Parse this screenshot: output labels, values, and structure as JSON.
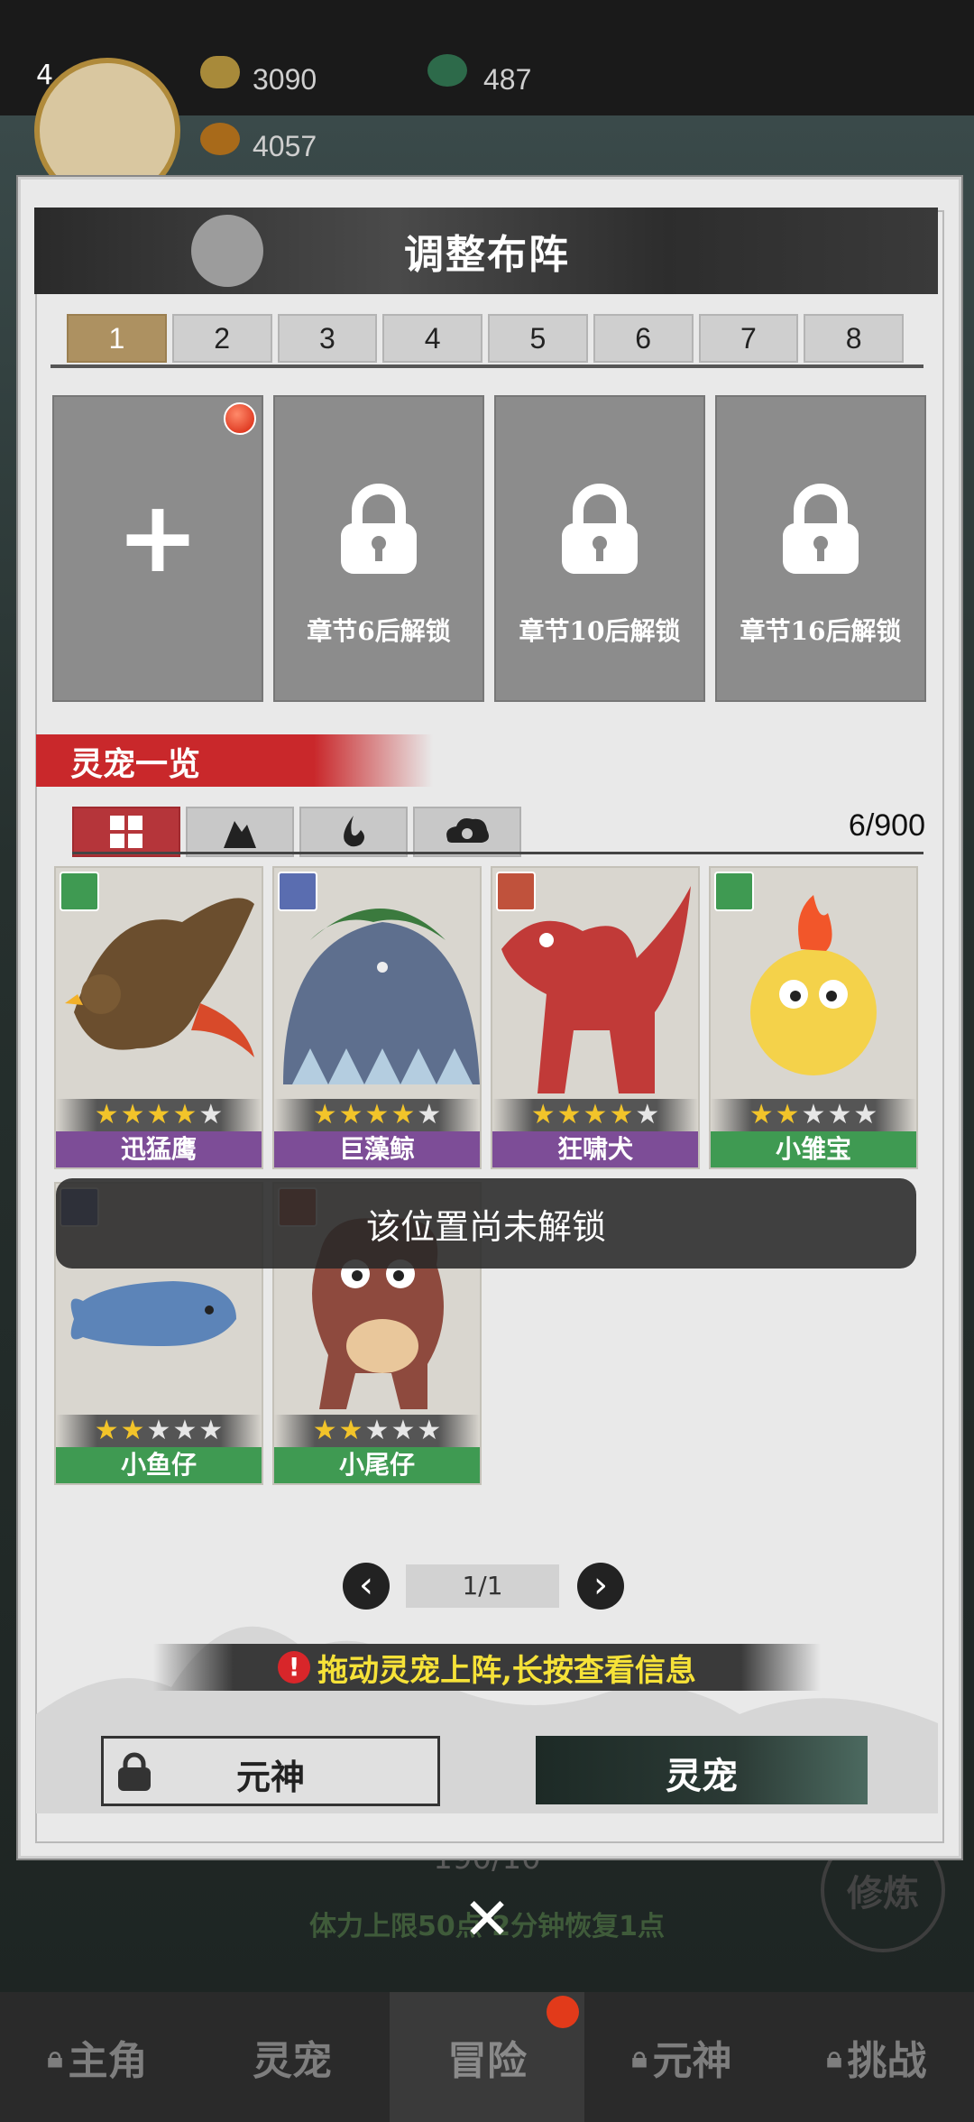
{
  "hud": {
    "level": "4",
    "gold": "3090",
    "jade": "487",
    "fire": "4057"
  },
  "dialog": {
    "title": "调整布阵",
    "tabs": [
      "1",
      "2",
      "3",
      "4",
      "5",
      "6",
      "7",
      "8"
    ],
    "active_tab": "1",
    "slots": [
      {
        "type": "add",
        "label": ""
      },
      {
        "type": "locked",
        "label": "章节6后解锁"
      },
      {
        "type": "locked",
        "label": "章节10后解锁"
      },
      {
        "type": "locked",
        "label": "章节16后解锁"
      }
    ],
    "section_title": "灵宠一览",
    "pet_count": "6/900",
    "filter_icons": [
      "grid-icon",
      "mountain-element-icon",
      "water-element-icon",
      "cloud-element-icon"
    ],
    "pets": [
      {
        "name": "迅猛鹰",
        "stars": 4,
        "element": "wind",
        "rarity": "purple"
      },
      {
        "name": "巨藻鲸",
        "stars": 4,
        "element": "water",
        "rarity": "purple"
      },
      {
        "name": "狂啸犬",
        "stars": 4,
        "element": "fire",
        "rarity": "purple"
      },
      {
        "name": "小雏宝",
        "stars": 2,
        "element": "wind",
        "rarity": "green"
      },
      {
        "name": "小鱼仔",
        "stars": 2,
        "element": "water",
        "rarity": "green"
      },
      {
        "name": "小尾仔",
        "stars": 2,
        "element": "fire",
        "rarity": "green"
      }
    ],
    "toast": "该位置尚未解锁",
    "page": "1/1",
    "hint": "拖动灵宠上阵,长按查看信息",
    "btn_soul": "元神",
    "btn_pet": "灵宠"
  },
  "background": {
    "stamina": "190/10",
    "stamina_note": "体力上限50点 2分钟恢复1点",
    "train": "修炼"
  },
  "bottom_nav": [
    "主角",
    "灵宠",
    "冒险",
    "元神",
    "挑战"
  ],
  "colors": {
    "active_tab": "#ad9161",
    "section_red": "#c9282b",
    "purple_rarity": "#7d4d97",
    "green_rarity": "#3f9a52",
    "hint_yellow": "#f6e238"
  }
}
